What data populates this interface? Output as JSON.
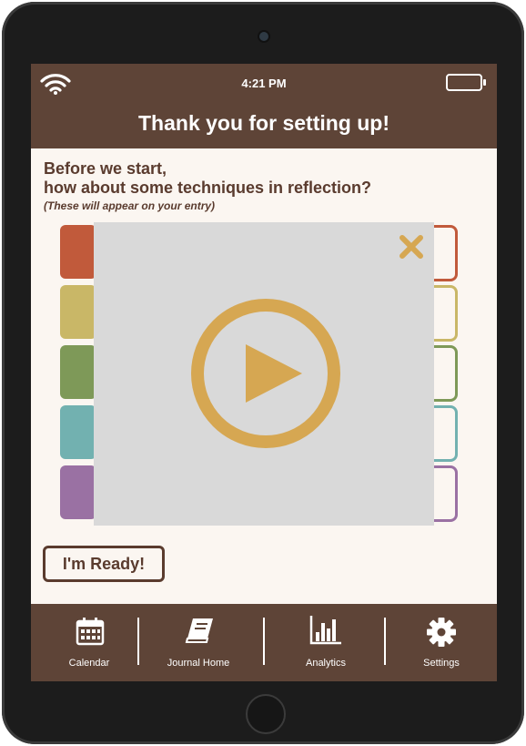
{
  "status_bar": {
    "time": "4:21 PM",
    "wifi_icon": "wifi-icon",
    "battery_icon": "battery-icon"
  },
  "header": {
    "title": "Thank you for setting up!"
  },
  "intro": {
    "line1": "Before we start,",
    "line2": "how about some techniques in reflection?",
    "note": "(These will appear on your entry)"
  },
  "technique_colors": [
    "#c15a3b",
    "#c9b767",
    "#7e9958",
    "#72b1b0",
    "#9a71a3"
  ],
  "ready_button": {
    "label": "I'm Ready!"
  },
  "video_modal": {
    "close_icon": "close-icon",
    "play_icon": "play-icon",
    "accent_color": "#d6a752"
  },
  "bottom_nav": {
    "items": [
      {
        "label": "Calendar",
        "icon": "calendar-icon"
      },
      {
        "label": "Journal Home",
        "icon": "journal-icon"
      },
      {
        "label": "Analytics",
        "icon": "analytics-icon"
      },
      {
        "label": "Settings",
        "icon": "settings-icon"
      }
    ]
  },
  "colors": {
    "brand_brown": "#5e4437",
    "text_brown": "#5a3b2e",
    "background_cream": "#fbf6f1",
    "modal_gray": "#d9d9d9"
  }
}
